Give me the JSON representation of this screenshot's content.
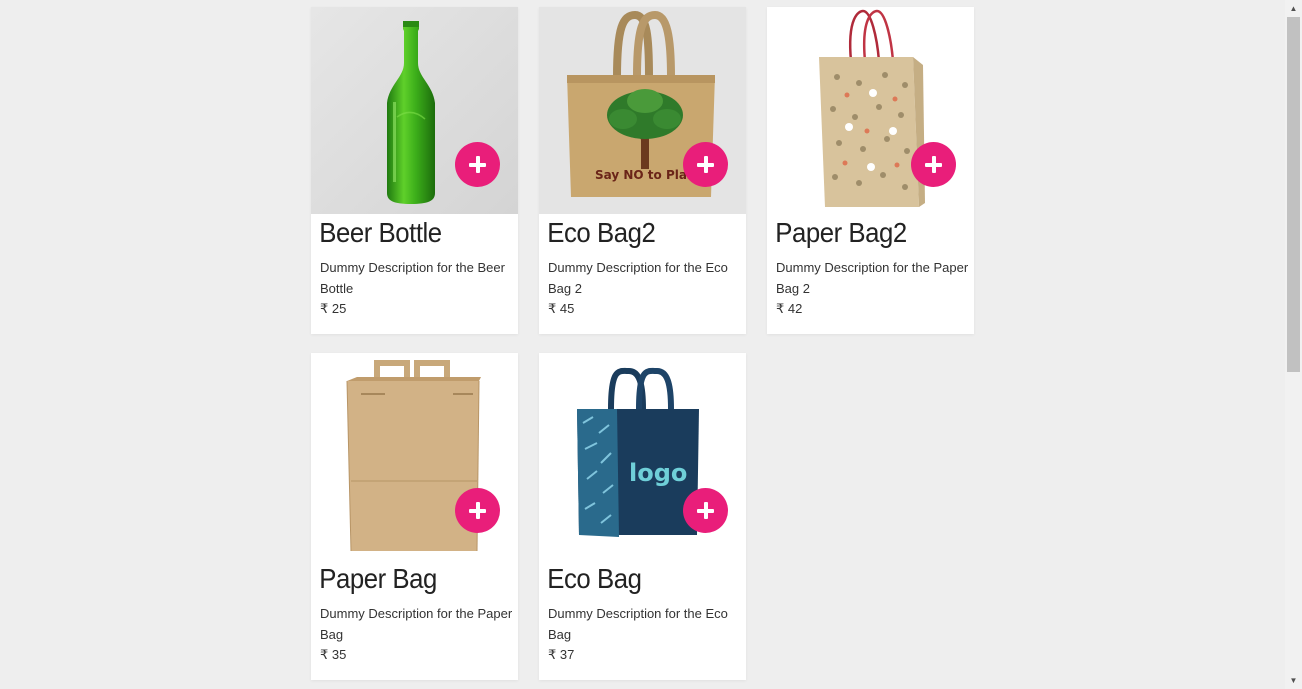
{
  "products": [
    {
      "name": "Beer Bottle",
      "description": "Dummy Description for the Beer Bottle",
      "price": "₹ 25",
      "image": "beer-bottle"
    },
    {
      "name": "Eco Bag2",
      "description": "Dummy Description for the Eco Bag 2",
      "price": "₹ 45",
      "image": "eco-bag-jute",
      "image_text": "Say NO to Plastic"
    },
    {
      "name": "Paper Bag2",
      "description": "Dummy Description for the Paper Bag 2",
      "price": "₹ 42",
      "image": "paper-bag-printed"
    },
    {
      "name": "Paper Bag",
      "description": "Dummy Description for the Paper Bag",
      "price": "₹ 35",
      "image": "paper-bag-kraft"
    },
    {
      "name": "Eco Bag",
      "description": "Dummy Description for the Eco Bag",
      "price": "₹ 37",
      "image": "eco-bag-blue",
      "image_text": "logo"
    }
  ],
  "add_button_icon": "plus-icon",
  "colors": {
    "accent": "#e91e7a",
    "background": "#eeeeee",
    "card": "#ffffff"
  }
}
